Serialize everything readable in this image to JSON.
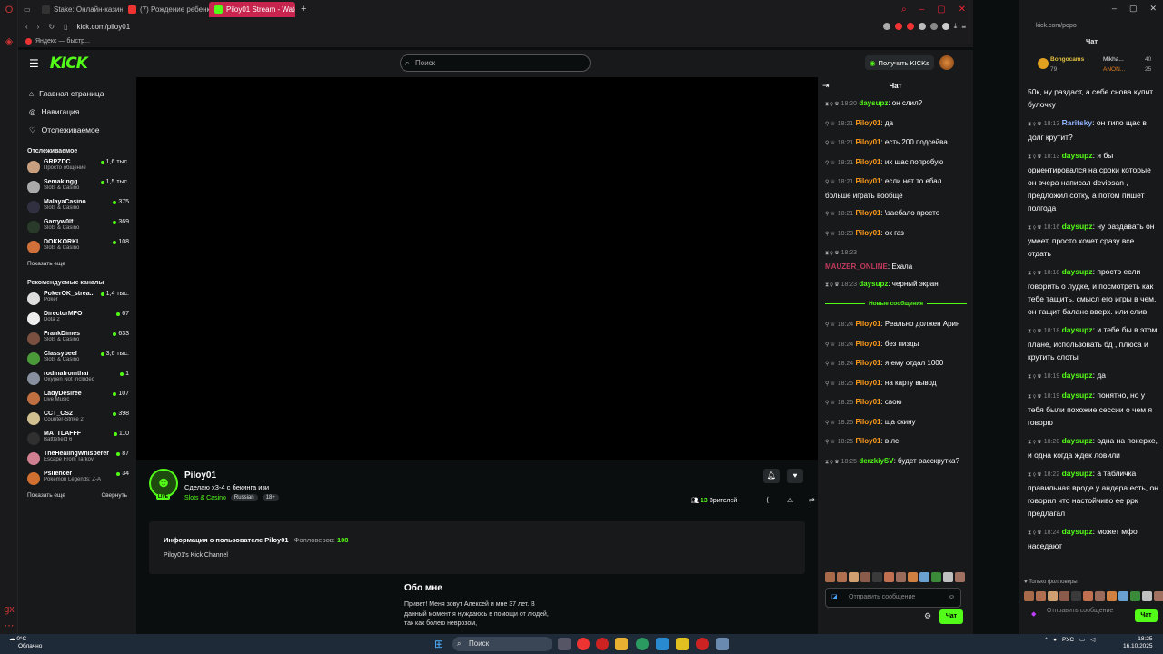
{
  "browser": {
    "tabs": [
      {
        "label": "Stake: Онлайн-казино и",
        "color": "#1b1b1e",
        "icon": "stake-icon"
      },
      {
        "label": "(7) Рождение ребенка о",
        "color": "#e33",
        "icon": "youtube-icon"
      },
      {
        "label": "Piloy01 Stream - Watc",
        "color": "#53fc18",
        "icon": "kick-icon"
      }
    ],
    "url": "kick.com/piloy01",
    "bookmark": "Яндекс — быстр..."
  },
  "header": {
    "logo": "KICK",
    "search_placeholder": "Поиск",
    "kicks_button": "Получить KICKs"
  },
  "sidebar": {
    "nav": [
      {
        "icon": "home-icon",
        "label": "Главная страница",
        "glyph": "⌂"
      },
      {
        "icon": "compass-icon",
        "label": "Навигация",
        "glyph": "◎"
      },
      {
        "icon": "heart-icon",
        "label": "Отслеживаемое",
        "glyph": "♡"
      }
    ],
    "following_title": "Отслеживаемое",
    "following": [
      {
        "name": "GRPZDC",
        "category": "Просто общение",
        "viewers": "1,6 тыс.",
        "color": "#c8a080"
      },
      {
        "name": "Semakingg",
        "category": "Slots & Casino",
        "viewers": "1,5 тыс.",
        "color": "#aaa"
      },
      {
        "name": "MalayaCasino",
        "category": "Slots & Casino",
        "viewers": "375",
        "color": "#303040"
      },
      {
        "name": "Garryw0lf",
        "category": "Slots & Casino",
        "viewers": "369",
        "color": "#2a3a2a"
      },
      {
        "name": "DOKKORKI",
        "category": "Slots & Casino",
        "viewers": "108",
        "color": "#d0703a"
      }
    ],
    "show_more": "Показать еще",
    "recommended_title": "Рекомендуемые каналы",
    "recommended": [
      {
        "name": "PokerOK_strea...",
        "category": "Poker",
        "viewers": "1,4 тыс.",
        "color": "#ddd"
      },
      {
        "name": "DirectorMFO",
        "category": "Dota 2",
        "viewers": "67",
        "color": "#eee"
      },
      {
        "name": "FrankDimes",
        "category": "Slots & Casino",
        "viewers": "633",
        "color": "#7a5040"
      },
      {
        "name": "Classybeef",
        "category": "Slots & Casino",
        "viewers": "3,6 тыс.",
        "color": "#4a9a3a"
      },
      {
        "name": "rodinafromthai",
        "category": "Oxygen Not Included",
        "viewers": "1",
        "color": "#8890a0"
      },
      {
        "name": "LadyDesiree",
        "category": "Live Music",
        "viewers": "107",
        "color": "#c07040"
      },
      {
        "name": "CCT_CS2",
        "category": "Counter-Strike 2",
        "viewers": "398",
        "color": "#d0c090"
      },
      {
        "name": "MATTLAFFF",
        "category": "Battlefield 6",
        "viewers": "110",
        "color": "#303030"
      },
      {
        "name": "TheHealingWhisperer",
        "category": "Escape From Tarkov",
        "viewers": "87",
        "color": "#d08090"
      },
      {
        "name": "Psilencer",
        "category": "Pokemon Legends: Z-A",
        "viewers": "34",
        "color": "#d07030"
      }
    ],
    "show_more2": "Показать еще",
    "collapse": "Свернуть"
  },
  "stream": {
    "streamer": "Piloy01",
    "title": "Сделаю х3-4 с бекинга изи",
    "category": "Slots & Casino",
    "tags": [
      "Russian",
      "18+"
    ],
    "live": "LIVE",
    "viewers_count": "13",
    "viewers_label": "Зрителей"
  },
  "about": {
    "title": "Информация о пользователе Piloy01",
    "followers_label": "Фолловеров:",
    "followers": "108",
    "channel": "Piloy01's Kick Channel",
    "bio_head": "Обо мне",
    "bio": "Привет! Меня зовут Алексей и мне 37 лет. В данный момент я нуждаюсь в помощи от людей, так как болею неврозом,"
  },
  "chat": {
    "title": "Чат",
    "new_messages": "Новые сообщения",
    "input_placeholder": "Отправить сообщение",
    "send": "Чат"
  },
  "popout": {
    "url": "kick.com/popo",
    "title": "Чат",
    "ad1": "Bongocams",
    "ad1_num": "79",
    "ad2": "Mikha...",
    "ad2_num": "40",
    "ad3": "ANON...",
    "ad3_num": "25",
    "followers_only": "Только фолловеры",
    "input_placeholder": "Отправить сообщение",
    "send": "Чат"
  },
  "taskbar": {
    "temp": "0°C",
    "weather": "Облачно",
    "search": "Поиск",
    "lang": "РУС",
    "time": "18:25",
    "date": "16.10.2025"
  }
}
